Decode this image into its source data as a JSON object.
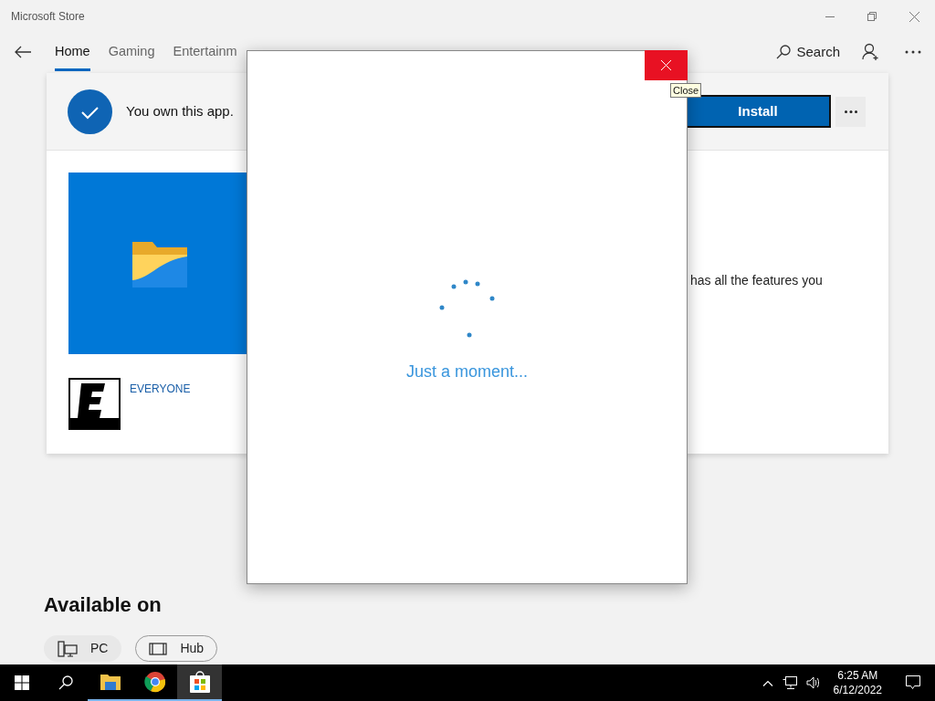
{
  "window": {
    "title": "Microsoft Store"
  },
  "nav": {
    "tabs": [
      {
        "label": "Home",
        "selected": true
      },
      {
        "label": "Gaming",
        "selected": false
      },
      {
        "label": "Entertainm",
        "selected": false
      }
    ],
    "search": "Search"
  },
  "ownership": {
    "message": "You own this app.",
    "install": "Install"
  },
  "product": {
    "rating": "EVERYONE",
    "description": "has all the features you"
  },
  "dialog": {
    "message": "Just a moment...",
    "tooltip": "Close"
  },
  "available_on": {
    "title": "Available on",
    "devices": [
      {
        "kind": "pc",
        "label": "PC",
        "selected": true
      },
      {
        "kind": "hub",
        "label": "Hub",
        "selected": false
      }
    ]
  },
  "taskbar": {
    "apps": [
      {
        "kind": "explorer",
        "running": true,
        "selected": false
      },
      {
        "kind": "chrome",
        "running": true,
        "selected": false
      },
      {
        "kind": "store",
        "running": true,
        "selected": true
      }
    ],
    "time": "6:25 AM",
    "date": "6/12/2022"
  }
}
